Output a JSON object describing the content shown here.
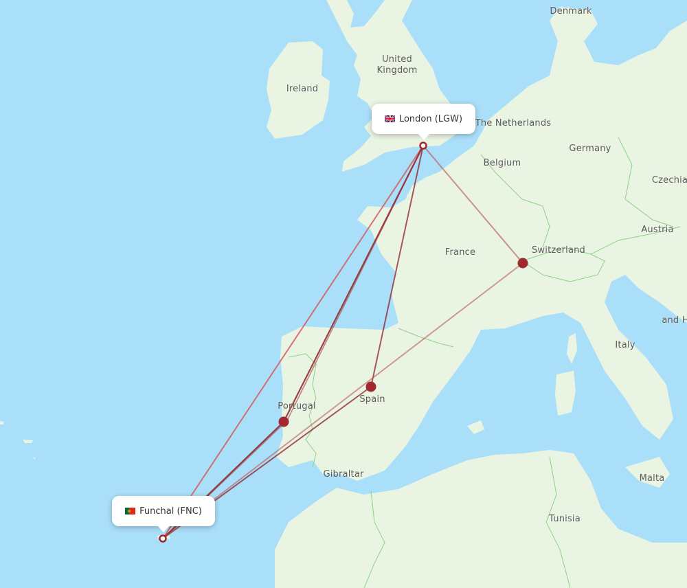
{
  "map": {
    "colors": {
      "water": "#aadff9",
      "land": "#eaf4e2",
      "border": "#8fcf86",
      "route": "#a0282e",
      "label": "#5a5a5a"
    },
    "country_labels": [
      {
        "id": "denmark",
        "text": "Denmark"
      },
      {
        "id": "united-kingdom",
        "text": "United\nKingdom"
      },
      {
        "id": "ireland",
        "text": "Ireland"
      },
      {
        "id": "the-netherlands",
        "text": "The Netherlands"
      },
      {
        "id": "germany",
        "text": "Germany"
      },
      {
        "id": "belgium",
        "text": "Belgium"
      },
      {
        "id": "czechia",
        "text": "Czechia"
      },
      {
        "id": "austria",
        "text": "Austria"
      },
      {
        "id": "switzerland",
        "text": "Switzerland"
      },
      {
        "id": "france",
        "text": "France"
      },
      {
        "id": "bosnia",
        "text": "and H"
      },
      {
        "id": "italy",
        "text": "Italy"
      },
      {
        "id": "spain",
        "text": "Spain"
      },
      {
        "id": "portugal",
        "text": "Portugal"
      },
      {
        "id": "gibraltar",
        "text": "Gibraltar"
      },
      {
        "id": "tunisia",
        "text": "Tunisia"
      },
      {
        "id": "malta",
        "text": "Malta"
      }
    ],
    "origin": {
      "city": "London",
      "code": "LGW",
      "label": "London (LGW)",
      "flag": "gb-flag-icon"
    },
    "destination": {
      "city": "Funchal",
      "code": "FNC",
      "label": "Funchal (FNC)",
      "flag": "pt-flag-icon"
    },
    "stopovers": [
      {
        "id": "lisbon",
        "region": "Portugal"
      },
      {
        "id": "madrid",
        "region": "Spain"
      },
      {
        "id": "geneva",
        "region": "Switzerland"
      }
    ],
    "routes": [
      {
        "id": "direct",
        "from": "LGW",
        "to": "FNC",
        "via": null
      },
      {
        "id": "via-lisbon",
        "from": "LGW",
        "to": "FNC",
        "via": "lisbon"
      },
      {
        "id": "via-madrid",
        "from": "LGW",
        "to": "FNC",
        "via": "madrid"
      },
      {
        "id": "via-geneva",
        "from": "LGW",
        "to": "FNC",
        "via": "geneva"
      }
    ]
  }
}
